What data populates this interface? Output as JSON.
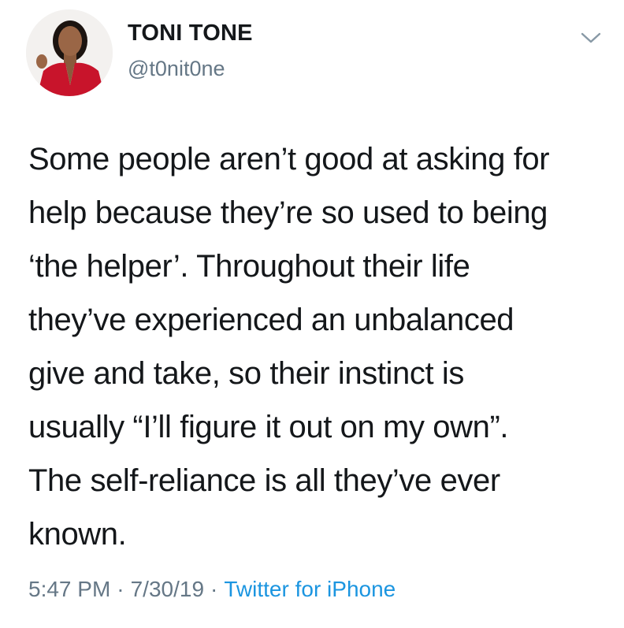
{
  "author": {
    "display_name": "TONI TONE",
    "handle": "@t0nit0ne"
  },
  "menu_icon": "chevron-down-icon",
  "tweet": {
    "lines": [
      "Some people aren’t good at asking for",
      "help because they’re so used to being",
      "‘the helper’. Throughout their life",
      "they’ve experienced an unbalanced",
      "give and take, so their instinct is",
      "usually “I’ll figure it out on my own”.",
      "The self-reliance is all they’ve ever",
      "known."
    ]
  },
  "meta": {
    "time": "5:47 PM",
    "separator": "·",
    "date": "7/30/19",
    "source": "Twitter for iPhone"
  },
  "colors": {
    "text": "#14171a",
    "secondary": "#657786",
    "link": "#1b95e0"
  }
}
